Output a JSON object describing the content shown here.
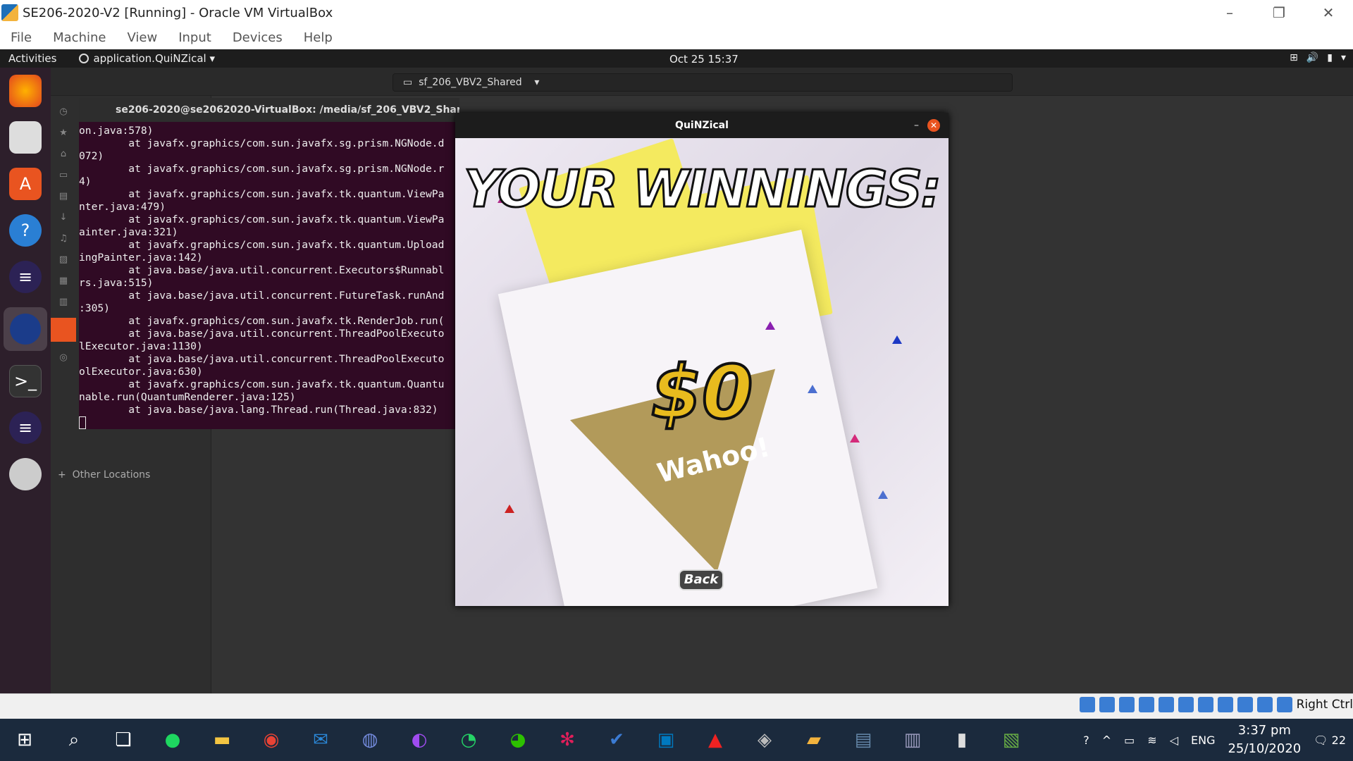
{
  "window": {
    "title": "SE206-2020-V2 [Running] - Oracle VM VirtualBox"
  },
  "menu": [
    "File",
    "Machine",
    "View",
    "Input",
    "Devices",
    "Help"
  ],
  "gnome": {
    "activities": "Activities",
    "app": "application.QuiNZical",
    "clock": "Oct 25  15:37"
  },
  "files": {
    "path": "sf_206_VBV2_Shared",
    "other_locations": "Other Locations"
  },
  "terminal": {
    "title": "se206-2020@se2062020-VirtualBox: /media/sf_206_VBV2_Share...",
    "lines": [
      "on.java:578)",
      "        at javafx.graphics/com.sun.javafx.sg.prism.NGNode.d",
      "072)",
      "        at javafx.graphics/com.sun.javafx.sg.prism.NGNode.r",
      "4)",
      "        at javafx.graphics/com.sun.javafx.tk.quantum.ViewPa",
      "nter.java:479)",
      "        at javafx.graphics/com.sun.javafx.tk.quantum.ViewPa",
      "ainter.java:321)",
      "        at javafx.graphics/com.sun.javafx.tk.quantum.Upload",
      "ingPainter.java:142)",
      "        at java.base/java.util.concurrent.Executors$Runnabl",
      "rs.java:515)",
      "        at java.base/java.util.concurrent.FutureTask.runAnd",
      ":305)",
      "        at javafx.graphics/com.sun.javafx.tk.RenderJob.run(",
      "        at java.base/java.util.concurrent.ThreadPoolExecuto",
      "lExecutor.java:1130)",
      "        at java.base/java.util.concurrent.ThreadPoolExecuto",
      "olExecutor.java:630)",
      "        at javafx.graphics/com.sun.javafx.tk.quantum.Quantu",
      "nable.run(QuantumRenderer.java:125)",
      "        at java.base/java.lang.Thread.run(Thread.java:832)"
    ]
  },
  "quiz": {
    "title": "QuiNZical",
    "heading": "YOUR WINNINGS:",
    "amount": "$0",
    "back": "Back",
    "card_text": "Wahoo!"
  },
  "vbox_status": {
    "host_key": "Right Ctrl"
  },
  "tray": {
    "lang": "ENG",
    "time": "3:37 pm",
    "date": "25/10/2020",
    "notifications": "22"
  }
}
